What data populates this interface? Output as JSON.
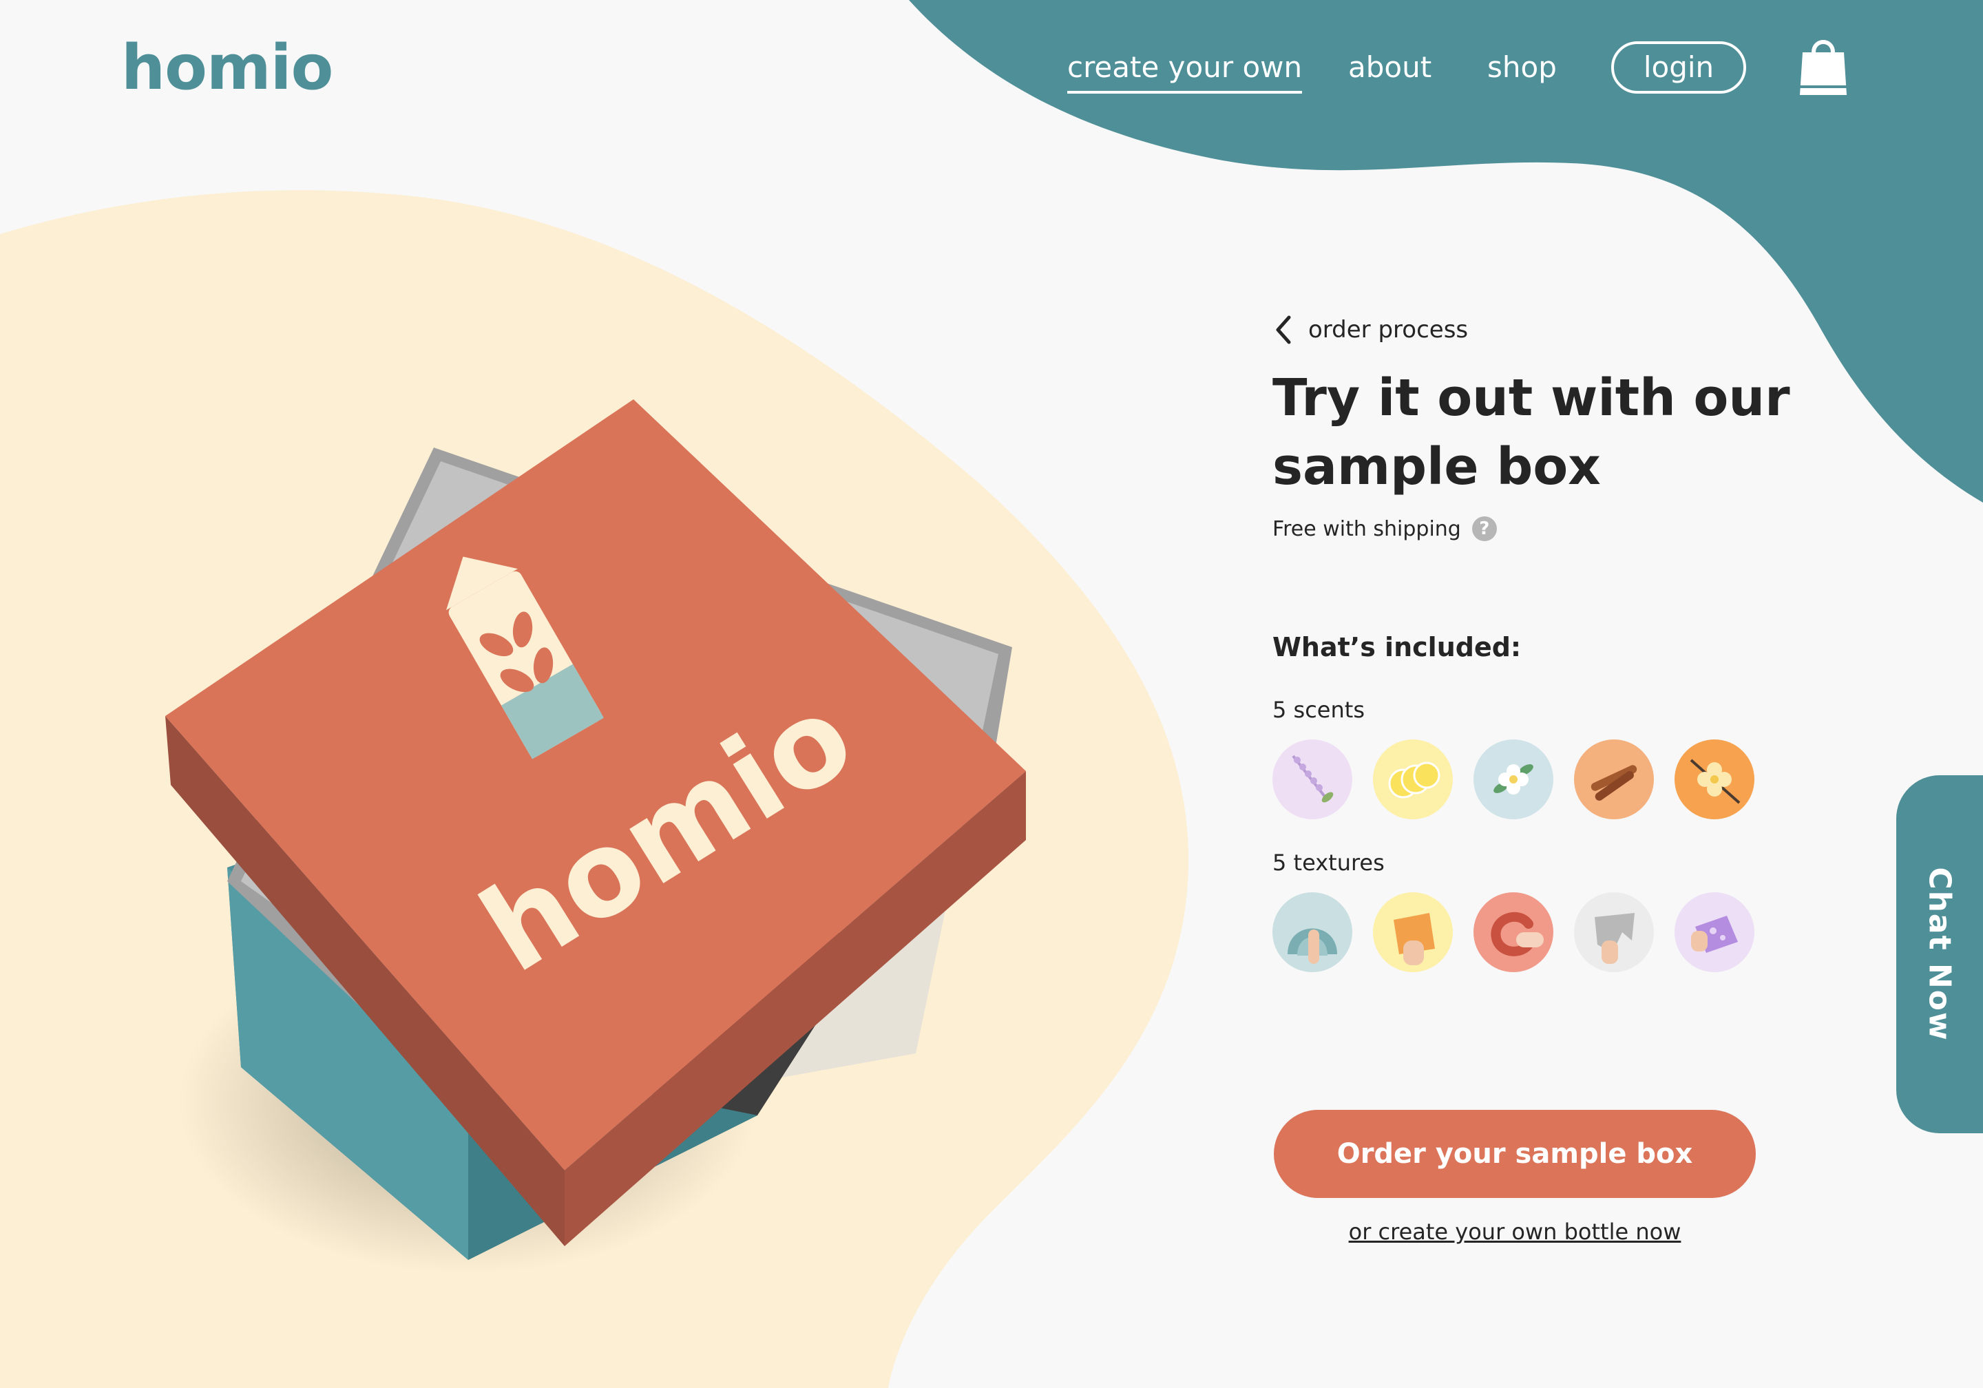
{
  "brand": {
    "logo_text": "homio"
  },
  "nav": {
    "items": [
      {
        "label": "create your own",
        "active": true
      },
      {
        "label": "about",
        "active": false
      },
      {
        "label": "shop",
        "active": false
      }
    ],
    "login_label": "login",
    "cart_icon": "shopping-bag-icon"
  },
  "product": {
    "back_label": "order process",
    "headline_line1": "Try it out with our",
    "headline_line2": "sample box",
    "shipping_note": "Free with shipping",
    "help_icon": "question-mark-icon",
    "included_heading": "What’s included:",
    "scents_label": "5 scents",
    "scents": [
      {
        "icon": "lavender-icon",
        "color": "#efdff5"
      },
      {
        "icon": "lemon-slices-icon",
        "color": "#fdf0a8"
      },
      {
        "icon": "jasmine-flower-icon",
        "color": "#cfe3e8"
      },
      {
        "icon": "cinnamon-sticks-icon",
        "color": "#f4b07d"
      },
      {
        "icon": "vanilla-flower-icon",
        "color": "#f7a24f"
      }
    ],
    "textures_label": "5 textures",
    "textures": [
      {
        "icon": "gel-texture-icon",
        "color": "#c9dfe1"
      },
      {
        "icon": "crumble-texture-icon",
        "color": "#fdf0a8"
      },
      {
        "icon": "cream-swirl-texture-icon",
        "color": "#f29a8a"
      },
      {
        "icon": "foil-texture-icon",
        "color": "#ececec"
      },
      {
        "icon": "soap-bar-texture-icon",
        "color": "#ecdff6"
      }
    ],
    "cta_label": "Order your sample box",
    "secondary_link": "or create your own bottle now"
  },
  "box_branding": {
    "lid_text": "homio"
  },
  "chat": {
    "label": "Chat Now"
  },
  "colors": {
    "teal": "#4e8f98",
    "coral": "#db7459",
    "cream": "#fdefd4",
    "text": "#252525"
  }
}
